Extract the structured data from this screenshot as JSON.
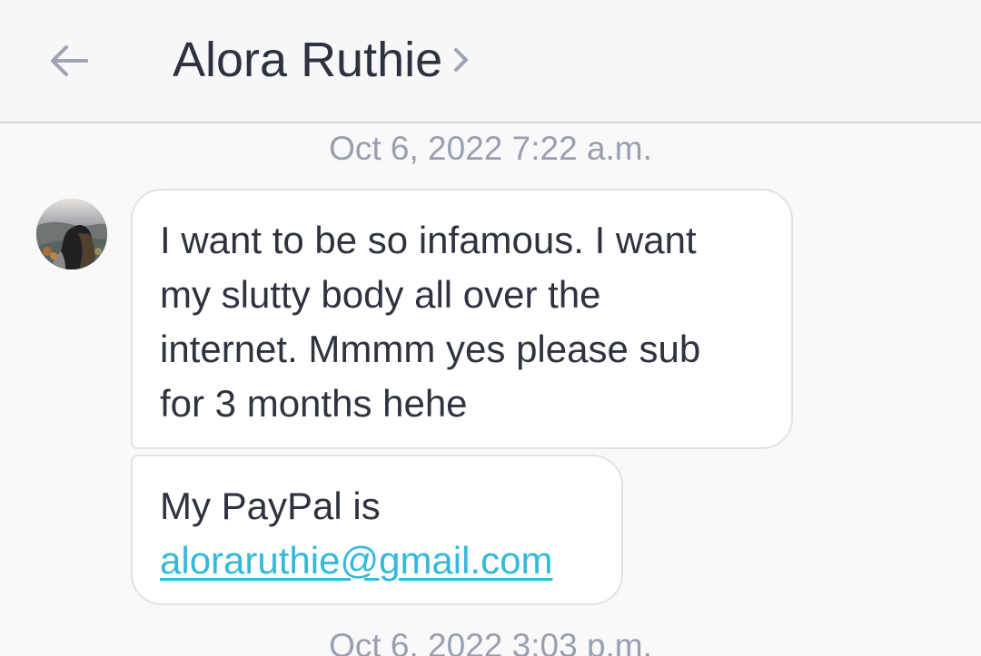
{
  "header": {
    "back_icon": "arrow-left-icon",
    "contact_name": "Alora Ruthie",
    "chevron_icon": "chevron-right-icon"
  },
  "conversation": {
    "timestamps": [
      "Oct 6, 2022 7:22 a.m.",
      "Oct 6, 2022 3:03 p.m."
    ],
    "messages": [
      {
        "lines": [
          "I want to be so infamous. I want",
          "my slutty body all over the",
          "internet. Mmmm yes please sub",
          "for 3 months hehe"
        ]
      },
      {
        "lines": [
          "My PayPal is"
        ],
        "email": "aloraruthie@gmail.com"
      }
    ]
  },
  "colors": {
    "background": "#f9f9fa",
    "text": "#2f3340",
    "muted_text": "#9a9eb0",
    "link": "#33b9dc",
    "bubble": "#ffffff",
    "divider": "#d8d9de"
  }
}
